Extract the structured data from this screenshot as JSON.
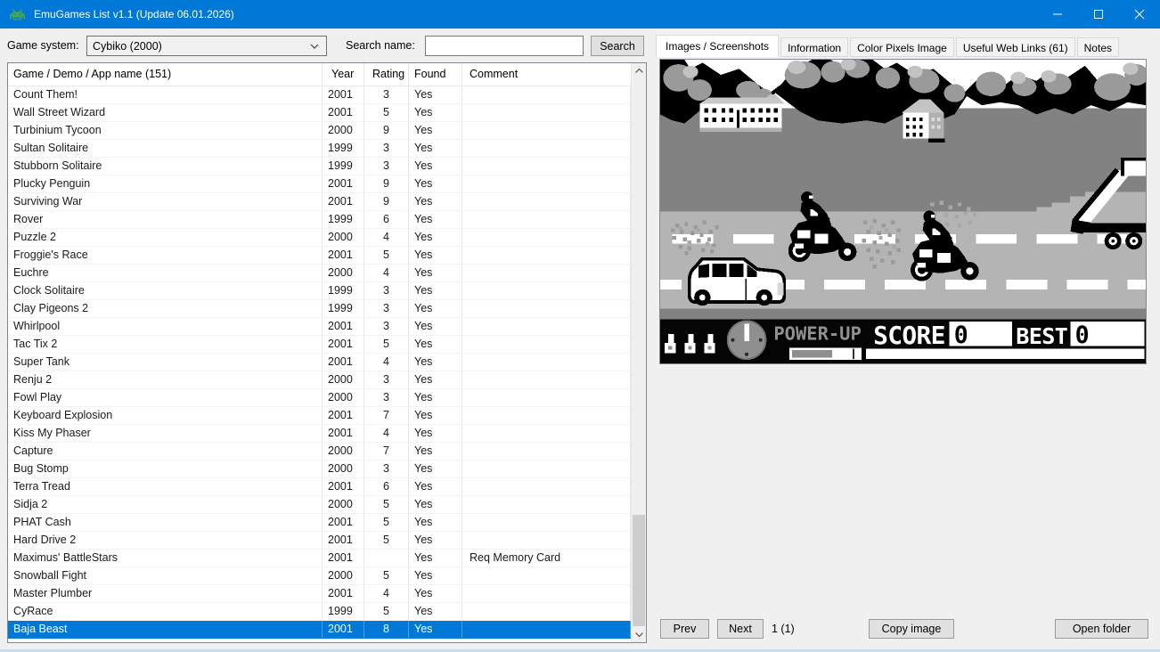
{
  "window": {
    "title": "EmuGames List v1.1 (Update 06.01.2026)"
  },
  "toolbar": {
    "game_system_label": "Game system:",
    "game_system_value": "Cybiko (2000)",
    "search_label": "Search name:",
    "search_placeholder": "",
    "search_button": "Search"
  },
  "table": {
    "columns": [
      "Game / Demo / App name (151)",
      "Year",
      "Rating",
      "Found",
      "Comment"
    ],
    "rows": [
      {
        "name": "Count Them!",
        "year": "2001",
        "rating": "3",
        "found": "Yes",
        "comment": ""
      },
      {
        "name": "Wall Street Wizard",
        "year": "2001",
        "rating": "5",
        "found": "Yes",
        "comment": ""
      },
      {
        "name": "Turbinium Tycoon",
        "year": "2000",
        "rating": "9",
        "found": "Yes",
        "comment": ""
      },
      {
        "name": "Sultan Solitaire",
        "year": "1999",
        "rating": "3",
        "found": "Yes",
        "comment": ""
      },
      {
        "name": "Stubborn Solitaire",
        "year": "1999",
        "rating": "3",
        "found": "Yes",
        "comment": ""
      },
      {
        "name": "Plucky Penguin",
        "year": "2001",
        "rating": "9",
        "found": "Yes",
        "comment": ""
      },
      {
        "name": "Surviving War",
        "year": "2001",
        "rating": "9",
        "found": "Yes",
        "comment": ""
      },
      {
        "name": "Rover",
        "year": "1999",
        "rating": "6",
        "found": "Yes",
        "comment": ""
      },
      {
        "name": "Puzzle 2",
        "year": "2000",
        "rating": "4",
        "found": "Yes",
        "comment": ""
      },
      {
        "name": "Froggie's Race",
        "year": "2001",
        "rating": "5",
        "found": "Yes",
        "comment": ""
      },
      {
        "name": "Euchre",
        "year": "2000",
        "rating": "4",
        "found": "Yes",
        "comment": ""
      },
      {
        "name": "Clock Solitaire",
        "year": "1999",
        "rating": "3",
        "found": "Yes",
        "comment": ""
      },
      {
        "name": "Clay Pigeons 2",
        "year": "1999",
        "rating": "3",
        "found": "Yes",
        "comment": ""
      },
      {
        "name": "Whirlpool",
        "year": "2001",
        "rating": "3",
        "found": "Yes",
        "comment": ""
      },
      {
        "name": "Tac Tix 2",
        "year": "2001",
        "rating": "5",
        "found": "Yes",
        "comment": ""
      },
      {
        "name": "Super Tank",
        "year": "2001",
        "rating": "4",
        "found": "Yes",
        "comment": ""
      },
      {
        "name": "Renju 2",
        "year": "2000",
        "rating": "3",
        "found": "Yes",
        "comment": ""
      },
      {
        "name": "Fowl Play",
        "year": "2000",
        "rating": "3",
        "found": "Yes",
        "comment": ""
      },
      {
        "name": "Keyboard Explosion",
        "year": "2001",
        "rating": "7",
        "found": "Yes",
        "comment": ""
      },
      {
        "name": "Kiss My Phaser",
        "year": "2001",
        "rating": "4",
        "found": "Yes",
        "comment": ""
      },
      {
        "name": "Capture",
        "year": "2000",
        "rating": "7",
        "found": "Yes",
        "comment": ""
      },
      {
        "name": "Bug Stomp",
        "year": "2000",
        "rating": "3",
        "found": "Yes",
        "comment": ""
      },
      {
        "name": "Terra Tread",
        "year": "2001",
        "rating": "6",
        "found": "Yes",
        "comment": ""
      },
      {
        "name": "Sidja 2",
        "year": "2000",
        "rating": "5",
        "found": "Yes",
        "comment": ""
      },
      {
        "name": "PHAT Cash",
        "year": "2001",
        "rating": "5",
        "found": "Yes",
        "comment": ""
      },
      {
        "name": "Hard Drive 2",
        "year": "2001",
        "rating": "5",
        "found": "Yes",
        "comment": ""
      },
      {
        "name": "Maximus' BattleStars",
        "year": "2001",
        "rating": "",
        "found": "Yes",
        "comment": "Req Memory Card"
      },
      {
        "name": "Snowball Fight",
        "year": "2000",
        "rating": "5",
        "found": "Yes",
        "comment": ""
      },
      {
        "name": "Master Plumber",
        "year": "2001",
        "rating": "4",
        "found": "Yes",
        "comment": ""
      },
      {
        "name": "CyRace",
        "year": "1999",
        "rating": "5",
        "found": "Yes",
        "comment": ""
      },
      {
        "name": "Baja Beast",
        "year": "2001",
        "rating": "8",
        "found": "Yes",
        "comment": "",
        "selected": true
      }
    ]
  },
  "tabs": {
    "items": [
      {
        "label": "Images / Screenshots",
        "active": true
      },
      {
        "label": "Information"
      },
      {
        "label": "Color Pixels Image"
      },
      {
        "label": "Useful Web Links (61)"
      },
      {
        "label": "Notes"
      }
    ]
  },
  "screenshot": {
    "hud": {
      "power_up": "POWER-UP",
      "score_label": "SCORE",
      "score_value": "0",
      "best_label": "BEST",
      "best_value": "0"
    }
  },
  "footer": {
    "prev": "Prev",
    "next": "Next",
    "index": "1 (1)",
    "copy_image": "Copy image",
    "open_folder": "Open folder"
  },
  "colors": {
    "titlebar": "#0078d7",
    "selection": "#0078d7",
    "screen_field": "#828282",
    "screen_road": "#b4b4b4"
  }
}
